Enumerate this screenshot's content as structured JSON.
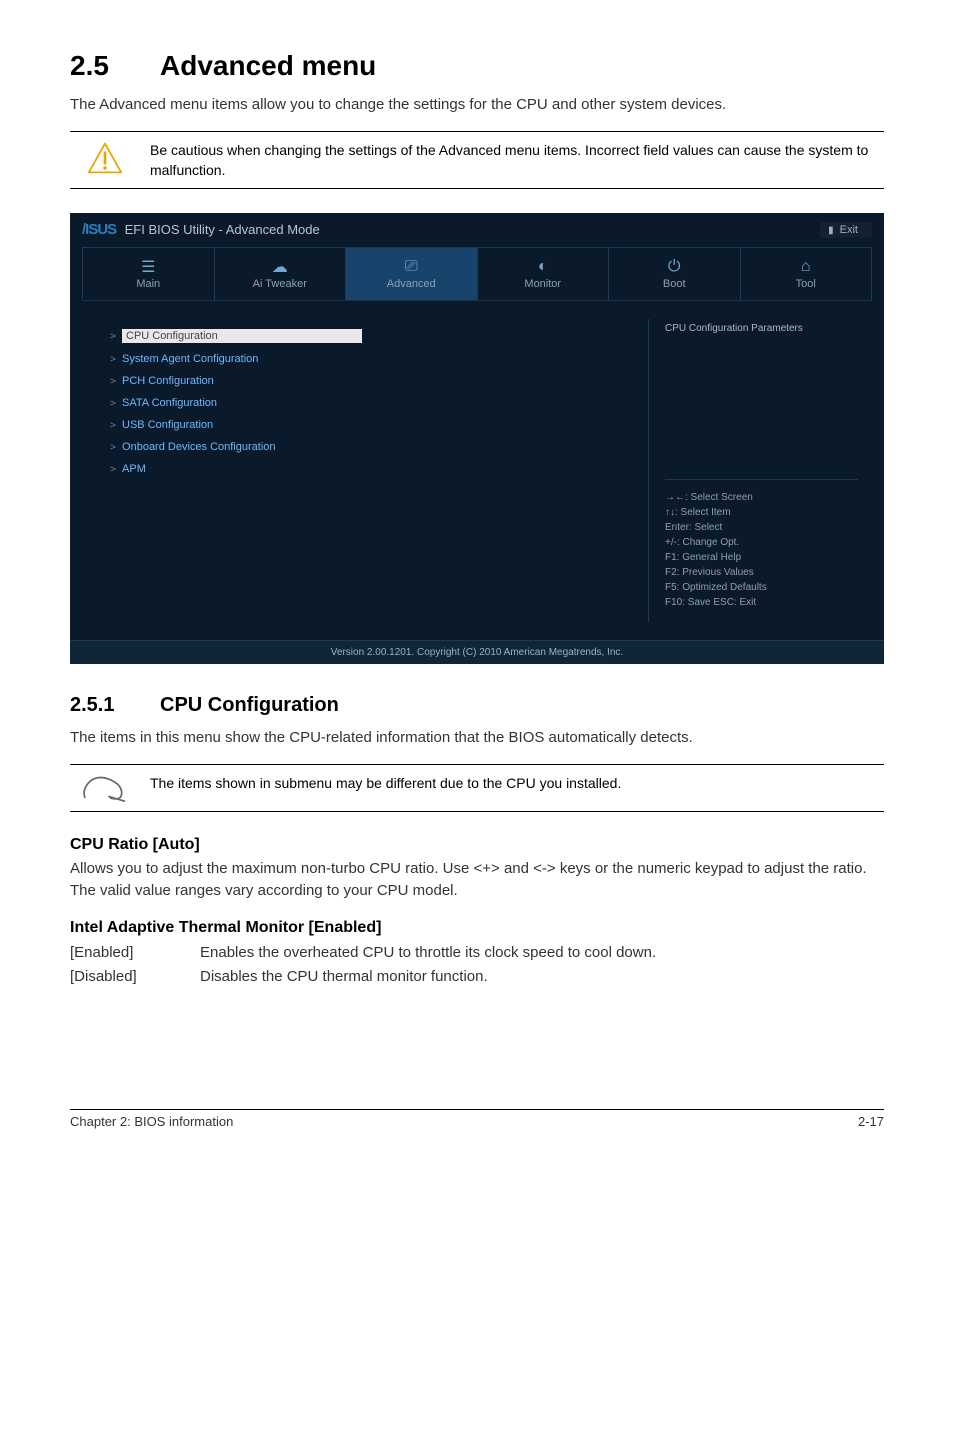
{
  "section": {
    "number": "2.5",
    "title": "Advanced menu"
  },
  "intro": "The Advanced menu items allow you to change the settings for the CPU and other system devices.",
  "caution": "Be cautious when changing the settings of the Advanced menu items. Incorrect field values can cause the system to malfunction.",
  "bios": {
    "brand": "/ISUS",
    "title": "EFI BIOS Utility - Advanced Mode",
    "exit": "Exit",
    "tabs": [
      {
        "label": "Main"
      },
      {
        "label": "Ai Tweaker"
      },
      {
        "label": "Advanced"
      },
      {
        "label": "Monitor"
      },
      {
        "label": "Boot"
      },
      {
        "label": "Tool"
      }
    ],
    "items": [
      "CPU Configuration",
      "System Agent Configuration",
      "PCH Configuration",
      "SATA Configuration",
      "USB Configuration",
      "Onboard Devices Configuration",
      "APM"
    ],
    "help_title": "CPU Configuration Parameters",
    "keys": [
      "→←: Select Screen",
      "↑↓: Select Item",
      "Enter: Select",
      "+/-: Change Opt.",
      "F1: General Help",
      "F2: Previous Values",
      "F5: Optimized Defaults",
      "F10: Save   ESC: Exit"
    ],
    "footer": "Version 2.00.1201.  Copyright (C) 2010 American Megatrends, Inc."
  },
  "subsection": {
    "number": "2.5.1",
    "title": "CPU Configuration"
  },
  "subsection_body": "The items in this menu show the CPU-related information that the BIOS automatically detects.",
  "note": "The items shown in submenu may be different due to the CPU you installed.",
  "items": [
    {
      "title": "CPU Ratio [Auto]",
      "body": "Allows you to adjust the maximum non-turbo CPU ratio. Use <+> and <-> keys or the numeric keypad to adjust the ratio. The valid value ranges vary according to your CPU model."
    },
    {
      "title": "Intel Adaptive Thermal Monitor [Enabled]",
      "options": [
        {
          "key": "[Enabled]",
          "val": "Enables the overheated CPU to throttle its clock speed to cool down."
        },
        {
          "key": "[Disabled]",
          "val": "Disables the CPU thermal monitor function."
        }
      ]
    }
  ],
  "footer": {
    "left": "Chapter 2: BIOS information",
    "right": "2-17"
  }
}
